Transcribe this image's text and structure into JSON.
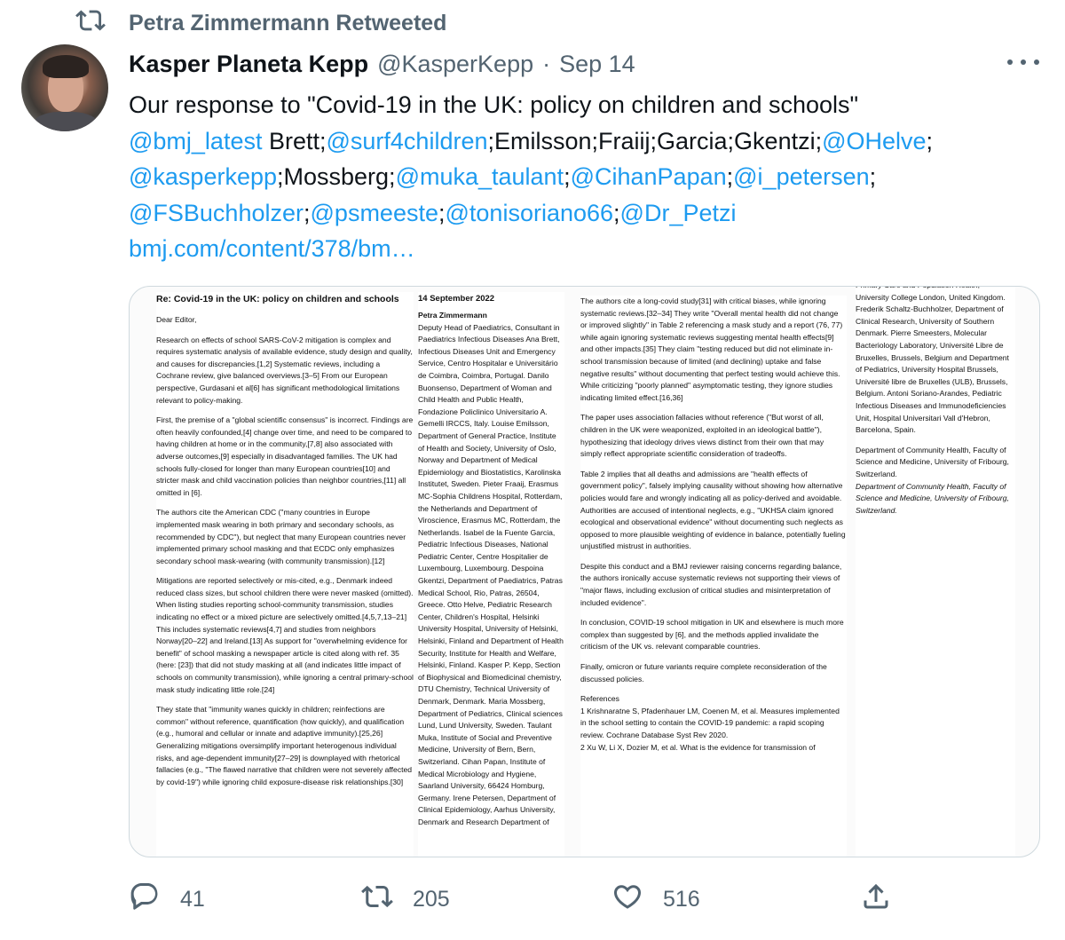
{
  "retweet": {
    "icon": "retweet-icon",
    "text": "Petra Zimmermann Retweeted"
  },
  "author": {
    "name": "Kasper Planeta Kepp",
    "handle": "@KasperKepp",
    "separator": "·",
    "date": "Sep 14"
  },
  "tweet": {
    "line1": "Our response to \"Covid-19 in the UK: policy on children and schools\"",
    "line2": {
      "m1": "@bmj_latest",
      "t1": " Brett;",
      "m2": "@surf4children",
      "t2": ";Emilsson;Fraiij;Garcia;Gkentzi;",
      "m3": "@OHelve",
      "t3": ";"
    },
    "line3": {
      "m1": "@kasperkepp",
      "t1": ";Mossberg;",
      "m2": "@muka_taulant",
      "t2": ";",
      "m3": "@CihanPapan",
      "t3": ";",
      "m4": "@i_petersen",
      "t4": ";"
    },
    "line4": {
      "m1": "@FSBuchholzer",
      "t1": ";",
      "m2": "@psmeeste",
      "t2": ";",
      "m3": "@tonisoriano66",
      "t3": ";",
      "m4": "@Dr_Petzi"
    },
    "link": "bmj.com/content/378/bm…"
  },
  "document": {
    "col1": {
      "title": "Re: Covid-19 in the UK: policy on children and schools",
      "salutation": "Dear Editor,",
      "p1": "Research on effects of school SARS-CoV-2 mitigation is complex and requires systematic analysis of available evidence, study design and quality, and causes for discrepancies.[1,2] Systematic reviews, including a Cochrane review, give balanced overviews.[3–5] From our European perspective, Gurdasani et al[6] has significant methodological limitations relevant to policy-making.",
      "p2": "First, the premise of a \"global scientific consensus\" is incorrect. Findings are often heavily confounded,[4] change over time, and need to be compared to having children at home or in the community,[7,8] also associated with adverse outcomes,[9] especially in disadvantaged families. The UK had schools fully-closed for longer than many European countries[10] and stricter mask and child vaccination policies than neighbor countries,[11] all omitted in [6].",
      "p3": "The authors cite the American CDC (\"many countries in Europe implemented mask wearing in both primary and secondary schools, as recommended by CDC\"), but neglect that many European countries never implemented primary school masking and that ECDC only emphasizes secondary school mask-wearing (with community transmission).[12]",
      "p4": "Mitigations are reported selectively or mis-cited, e.g., Denmark indeed reduced class sizes, but school children there were never masked (omitted). When listing studies reporting school-community transmission, studies indicating no effect or a mixed picture are selectively omitted.[4,5,7,13–21] This includes systematic reviews[4,7] and studies from neighbors Norway[20–22] and Ireland.[13] As support for \"overwhelming evidence for benefit\" of school masking a newspaper article is cited along with ref. 35 (here: [23]) that did not study masking at all (and indicates little impact of schools on community transmission), while ignoring a central primary-school mask study indicating little role.[24]",
      "p5": "They state that \"immunity wanes quickly in children; reinfections are common\" without reference, quantification (how quickly), and qualification (e.g., humoral and cellular or innate and adaptive immunity).[25,26] Generalizing mitigations oversimplify important heterogenous individual risks, and age-dependent immunity[27–29] is downplayed with rhetorical fallacies (e.g., \"The flawed narrative that children were not severely affected by covid-19\") while ignoring child exposure-disease risk relationships.[30]"
    },
    "col2": {
      "date": "14 September 2022",
      "author": "Petra Zimmermann",
      "affiliations": "Deputy Head of Paediatrics, Consultant in Paediatrics Infectious Diseases Ana Brett, Infectious Diseases Unit and Emergency Service, Centro Hospitalar e Universitário de Coimbra, Coimbra, Portugal. Danilo Buonsenso, Department of Woman and Child Health and Public Health, Fondazione Policlinico Universitario A. Gemelli IRCCS, Italy. Louise Emilsson, Department of General Practice, Institute of Health and Society, University of Oslo, Norway and Department of Medical Epidemiology and Biostatistics, Karolinska Institutet, Sweden. Pieter Fraaij, Erasmus MC-Sophia Childrens Hospital, Rotterdam, the Netherlands and Department of Viroscience, Erasmus MC, Rotterdam, the Netherlands. Isabel de la Fuente Garcia, Pediatric Infectious Diseases, National Pediatric Center, Centre Hospitalier de Luxembourg, Luxembourg. Despoina Gkentzi, Department of Paediatrics, Patras Medical School, Rio, Patras, 26504, Greece. Otto Helve, Pediatric Research Center, Children's Hospital, Helsinki University Hospital, University of Helsinki, Helsinki, Finland and Department of Health Security, Institute for Health and Welfare, Helsinki, Finland. Kasper P. Kepp, Section of Biophysical and Biomedicinal chemistry, DTU Chemistry, Technical University of Denmark, Denmark. Maria Mossberg, Department of Pediatrics, Clinical sciences Lund, Lund University, Sweden. Taulant Muka, Institute of Social and Preventive Medicine, University of Bern, Bern, Switzerland. Cihan Papan, Institute of Medical Microbiology and Hygiene, Saarland University, 66424 Homburg, Germany. Irene Petersen, Department of Clinical Epidemiology, Aarhus University, Denmark and Research Department of"
    },
    "col3": {
      "p1": "The authors cite a long-covid study[31] with critical biases, while ignoring systematic reviews.[32–34] They write \"Overall mental health did not change or improved slightly\" in Table 2 referencing a mask study and a report (76, 77) while again ignoring systematic reviews suggesting mental health effects[9] and other impacts.[35] They claim \"testing reduced but did not eliminate in-school transmission because of limited (and declining) uptake and false negative results\" without documenting that perfect testing would achieve this. While criticizing \"poorly planned\" asymptomatic testing, they ignore studies indicating limited effect.[16,36]",
      "p2": "The paper uses association fallacies without reference (\"But worst of all, children in the UK were weaponized, exploited in an ideological battle\"), hypothesizing that ideology drives views distinct from their own that may simply reflect appropriate scientific consideration of tradeoffs.",
      "p3": "Table 2 implies that all deaths and admissions are \"health effects of government policy\", falsely implying causality without showing how alternative policies would fare and wrongly indicating all as policy-derived and avoidable. Authorities are accused of intentional neglects, e.g., \"UKHSA claim ignored ecological and observational evidence\" without documenting such neglects as opposed to more plausible weighting of evidence in balance, potentially fueling unjustified mistrust in authorities.",
      "p4": "Despite this conduct and a BMJ reviewer raising concerns regarding balance, the authors ironically accuse systematic reviews not supporting their views of \"major flaws, including exclusion of critical studies and misinterpretation of included evidence\".",
      "p5": "In conclusion, COVID-19 school mitigation in UK and elsewhere is much more complex than suggested by [6], and the methods applied invalidate the criticism of the UK vs. relevant comparable countries.",
      "p6": "Finally, omicron or future variants require complete reconsideration of the discussed policies.",
      "refs_title": "References",
      "ref1": "1 Krishnaratne S, Pfadenhauer LM, Coenen M, et al. Measures implemented in the school setting to contain the COVID-19 pandemic: a rapid scoping review. Cochrane Database Syst Rev 2020.",
      "ref2": "2 Xu W, Li X, Dozier M, et al. What is the evidence for transmission of"
    },
    "col4": {
      "p1": "Primary Care and Population Health, University College London, United Kingdom. Frederik Schaltz-Buchholzer, Department of Clinical Research, University of Southern Denmark. Pierre Smeesters, Molecular Bacteriology Laboratory, Université Libre de Bruxelles, Brussels, Belgium and Department of Pediatrics, University Hospital Brussels, Université libre de Bruxelles (ULB), Brussels, Belgium. Antoni Soriano-Arandes, Pediatric Infectious Diseases and Immunodeficiencies Unit, Hospital Universitari Vall d'Hebron, Barcelona, Spain.",
      "p2": "Department of Community Health, Faculty of Science and Medicine, University of Fribourg, Switzerland.",
      "p3": "Department of Community Health, Faculty of Science and Medicine, University of Fribourg, Switzerland."
    }
  },
  "actions": {
    "reply": {
      "icon": "reply-icon",
      "count": "41"
    },
    "retweet": {
      "icon": "retweet-icon",
      "count": "205"
    },
    "like": {
      "icon": "heart-icon",
      "count": "516"
    },
    "share": {
      "icon": "share-icon"
    }
  },
  "colors": {
    "text": "#0f1419",
    "secondary": "#536471",
    "link": "#1d9bf0",
    "border": "#cfd9de"
  }
}
